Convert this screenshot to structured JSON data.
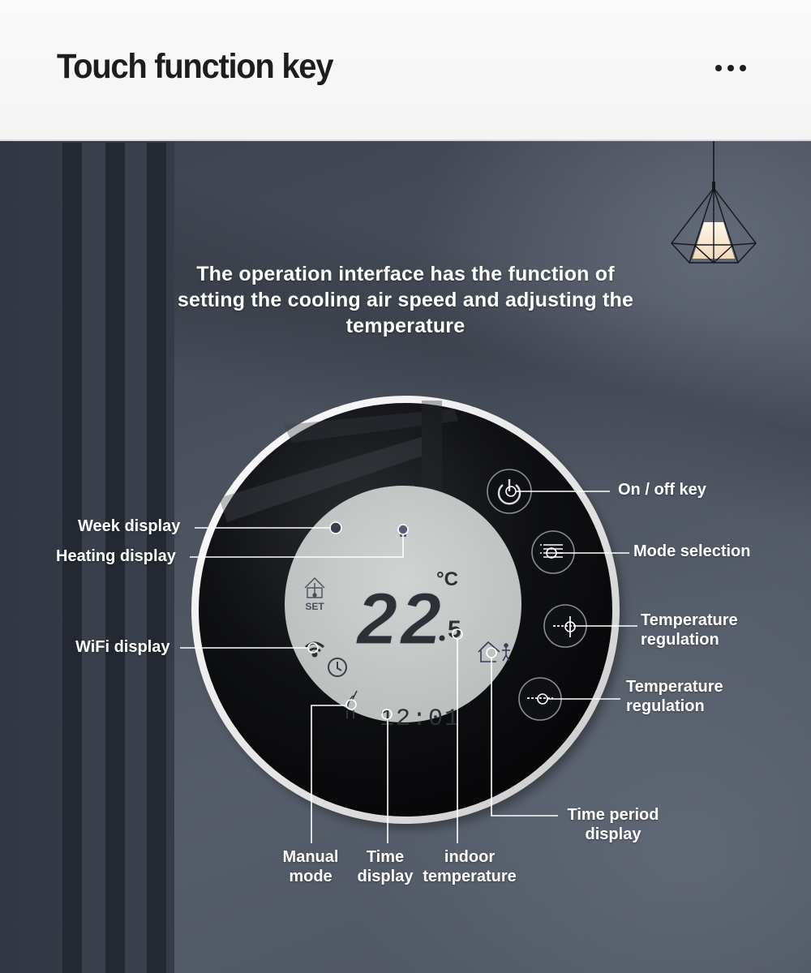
{
  "header": {
    "title": "Touch function key",
    "more_icon": "more-horizontal-icon"
  },
  "intro": {
    "line1": "The operation interface has the function of",
    "line2": "setting the cooling air speed and adjusting the",
    "line3": "temperature"
  },
  "display": {
    "temperature_integer": "22",
    "temperature_decimal": "5",
    "unit": "°C",
    "set_label": "SET",
    "time": "12:01",
    "icons": [
      "week-display-icon",
      "heating-icon",
      "set-house-thermometer-icon",
      "wifi-icon",
      "clock-icon",
      "manual-mode-hand-icon",
      "time-period-house-person-icon"
    ]
  },
  "keys": [
    {
      "name": "power",
      "icon": "power-icon"
    },
    {
      "name": "mode",
      "icon": "mode-lines-icon"
    },
    {
      "name": "temp-up",
      "icon": "plus-icon"
    },
    {
      "name": "temp-down",
      "icon": "minus-icon"
    }
  ],
  "callouts": {
    "on_off": "On / off key",
    "mode_selection": "Mode selection",
    "temp_up_line1": "Temperature",
    "temp_up_line2": "regulation",
    "temp_down_line1": "Temperature",
    "temp_down_line2": "regulation",
    "time_period_line1": "Time period",
    "time_period_line2": "display",
    "week_display": "Week display",
    "heating_display": "Heating display",
    "wifi_display": "WiFi display",
    "manual_line1": "Manual",
    "manual_line2": "mode",
    "time_line1": "Time",
    "time_line2": "display",
    "indoor_line1": "indoor",
    "indoor_line2": "temperature"
  },
  "colors": {
    "header_bg": "#f5f5f5",
    "title_text": "#1d1d1d",
    "wall": "#4a505c",
    "lcd": "#c5cac8",
    "lcd_segment": "#2e3036",
    "glass": "#0b0c0f",
    "rim": "#f2f2f2",
    "callout": "#ffffff"
  }
}
